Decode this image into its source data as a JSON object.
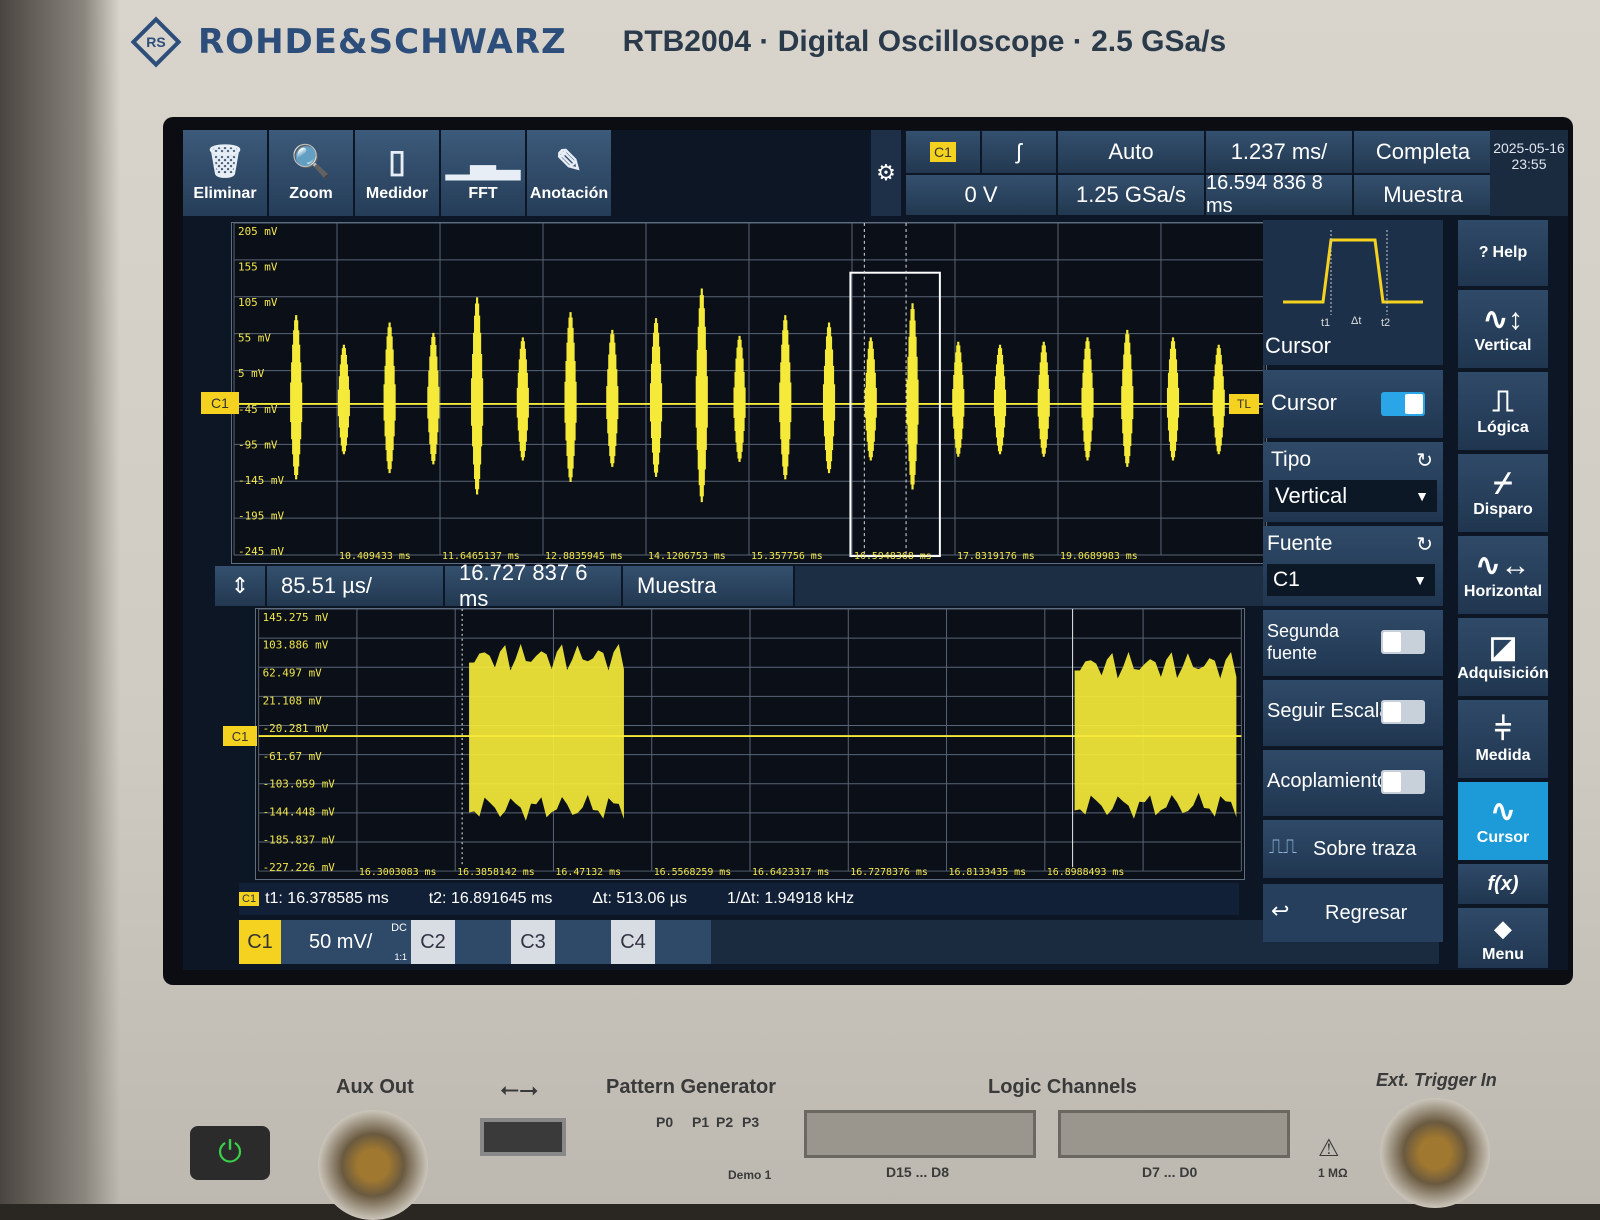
{
  "brand": {
    "name": "ROHDE&SCHWARZ",
    "model": "RTB2004 · Digital Oscilloscope · 2.5 GSa/s"
  },
  "toolbar": [
    {
      "label": "Eliminar",
      "icon": "trash-icon"
    },
    {
      "label": "Zoom",
      "icon": "zoom-icon"
    },
    {
      "label": "Medidor",
      "icon": "meter-icon"
    },
    {
      "label": "FFT",
      "icon": "fft-icon"
    },
    {
      "label": "Anotación",
      "icon": "pencil-icon"
    }
  ],
  "trigger": {
    "source": "C1",
    "level": "0 V",
    "mode": "Auto",
    "sample_rate": "1.25 GSa/s",
    "slope_icon": "rising-edge-icon"
  },
  "timebase": {
    "scale": "1.237 ms/",
    "position": "16.594 836 8 ms"
  },
  "acquisition": {
    "mode": "Completa",
    "type": "Muestra"
  },
  "datetime": {
    "date": "2025-05-16",
    "time": "23:55"
  },
  "main_plot": {
    "y_ticks": [
      "205 mV",
      "155 mV",
      "105 mV",
      "55 mV",
      "5 mV",
      "-45 mV",
      "-95 mV",
      "-145 mV",
      "-195 mV",
      "-245 mV"
    ],
    "x_ticks": [
      "10.409433 ms",
      "11.6465137 ms",
      "12.8835945 ms",
      "14.1206753 ms",
      "15.357756 ms",
      "16.5948368 ms",
      "17.8319176 ms",
      "19.0689983 ms"
    ],
    "channel_marker": "C1",
    "trigger_marker": "TL"
  },
  "zoom_bar": {
    "scale": "85.51 µs/",
    "position": "16.727 837 6 ms",
    "type": "Muestra"
  },
  "zoom_plot": {
    "y_ticks": [
      "145.275 mV",
      "103.886 mV",
      "62.497 mV",
      "21.108 mV",
      "-20.281 mV",
      "-61.67 mV",
      "-103.059 mV",
      "-144.448 mV",
      "-185.837 mV",
      "-227.226 mV"
    ],
    "x_ticks": [
      "16.3003083 ms",
      "16.3858142 ms",
      "16.47132 ms",
      "16.5568259 ms",
      "16.6423317 ms",
      "16.7278376 ms",
      "16.8133435 ms",
      "16.8988493 ms"
    ],
    "channel_marker": "C1"
  },
  "cursor_readout": {
    "ch": "C1",
    "t1": "t1: 16.378585 ms",
    "t2": "t2: 16.891645 ms",
    "dt": "Δt: 513.06 µs",
    "inv": "1/Δt: 1.94918 kHz"
  },
  "channels": [
    {
      "name": "C1",
      "scale": "50 mV/",
      "coupling": "DC",
      "probe": "1:1"
    },
    {
      "name": "C2"
    },
    {
      "name": "C3"
    },
    {
      "name": "C4"
    }
  ],
  "side_panel": {
    "title": "Cursor",
    "diagram_labels": {
      "t1": "t1",
      "dt": "Δt",
      "t2": "t2"
    },
    "cursor_label": "Cursor",
    "tipo_label": "Tipo",
    "tipo_value": "Vertical",
    "fuente_label": "Fuente",
    "fuente_value": "C1",
    "segunda_fuente_label_1": "Segunda",
    "segunda_fuente_label_2": "fuente",
    "seguir_escala_label": "Seguir Escala",
    "acoplamiento_label": "Acoplamiento",
    "sobre_traza_label": "Sobre traza",
    "regresar_label": "Regresar"
  },
  "right_nav": [
    {
      "label": "Help",
      "icon": "help-icon"
    },
    {
      "label": "Vertical",
      "icon": "vertical-icon"
    },
    {
      "label": "Lógica",
      "icon": "logic-icon"
    },
    {
      "label": "Disparo",
      "icon": "trigger-icon"
    },
    {
      "label": "Horizontal",
      "icon": "horizontal-icon"
    },
    {
      "label": "Adquisición",
      "icon": "acquisition-icon"
    },
    {
      "label": "Medida",
      "icon": "measure-icon"
    },
    {
      "label": "Cursor",
      "icon": "cursor-icon"
    },
    {
      "label": "f(x)",
      "icon": "function-icon"
    },
    {
      "label": "Menu",
      "icon": "rs-menu-icon"
    }
  ],
  "front_panel": {
    "aux_out": "Aux Out",
    "pattern_generator": "Pattern Generator",
    "pattern_pins": [
      "P0",
      "P1",
      "P2",
      "P3"
    ],
    "logic_channels": "Logic Channels",
    "logic_d15": "D15 ... D8",
    "logic_d7": "D7 ... D0",
    "ext_trigger": "Ext. Trigger In",
    "ext_trigger_imp": "1 MΩ",
    "demo": "Demo 1"
  },
  "colors": {
    "trace": "#f5ea3a",
    "accent": "#1c9bd8",
    "panel": "#2f4a68"
  }
}
